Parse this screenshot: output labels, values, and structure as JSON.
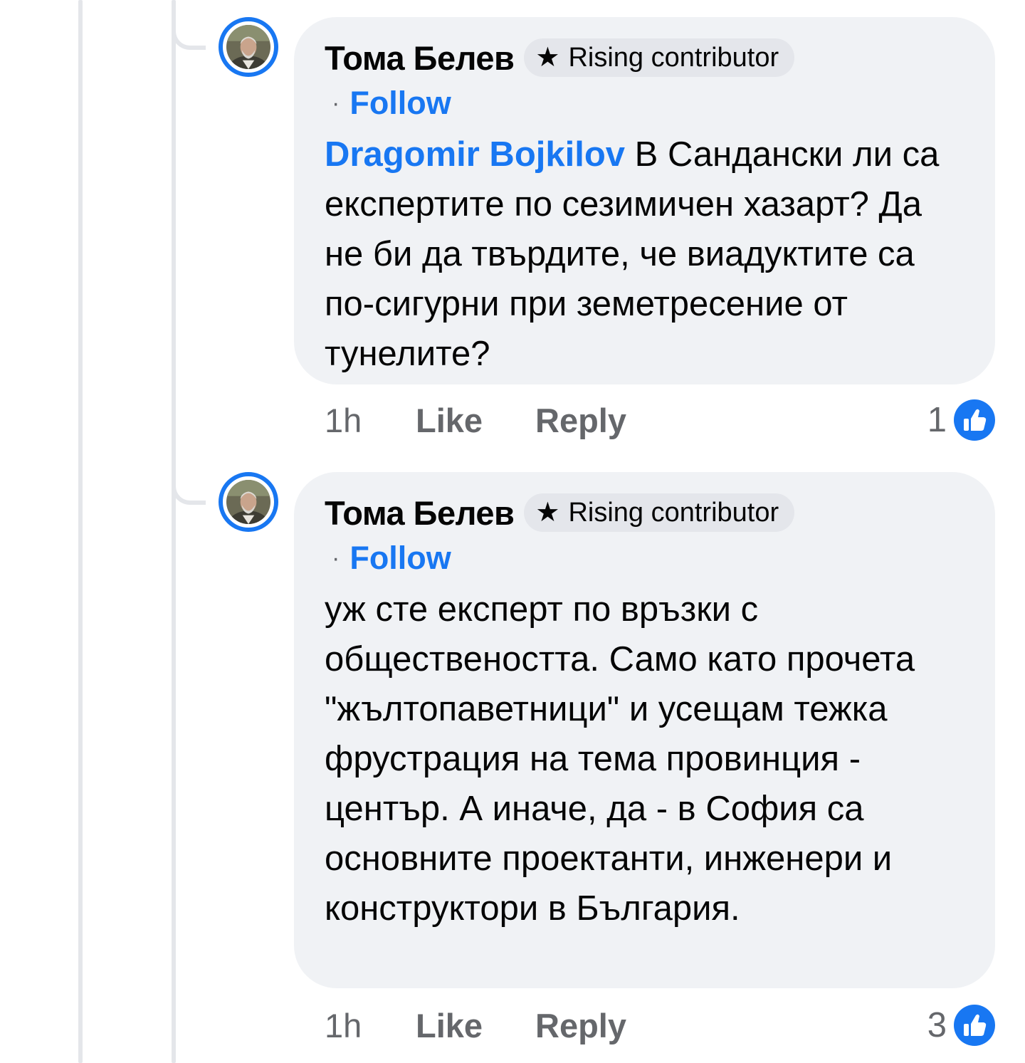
{
  "comments": [
    {
      "author": "Тома Белев",
      "badge": "Rising contributor",
      "follow_label": "Follow",
      "mention": "Dragomir Bojkilov",
      "text": " В Сандански ли са експертите по сезимичен хазарт? Да не би да твърдите, че виадуктите са по-сигурни при земетресение от тунелите?",
      "time": "1h",
      "like_label": "Like",
      "reply_label": "Reply",
      "reaction_count": "1"
    },
    {
      "author": "Тома Белев",
      "badge": "Rising contributor",
      "follow_label": "Follow",
      "mention": "",
      "text": "уж сте експерт по връзки с обществеността. Само като прочета \"жълтопаветници\" и усещам тежка фрустрация на тема провинция - център. А иначе, да - в София са основните проектанти, инженери и конструктори в България.",
      "time": "1h",
      "like_label": "Like",
      "reply_label": "Reply",
      "reaction_count": "3"
    }
  ],
  "icons": {
    "badge": "star-icon",
    "reaction": "thumbs-up-icon",
    "avatar": "user-photo"
  },
  "colors": {
    "accent": "#1877f2",
    "bubble": "#f0f2f5",
    "muted_text": "#65676b",
    "badge_bg": "#e4e6eb"
  }
}
